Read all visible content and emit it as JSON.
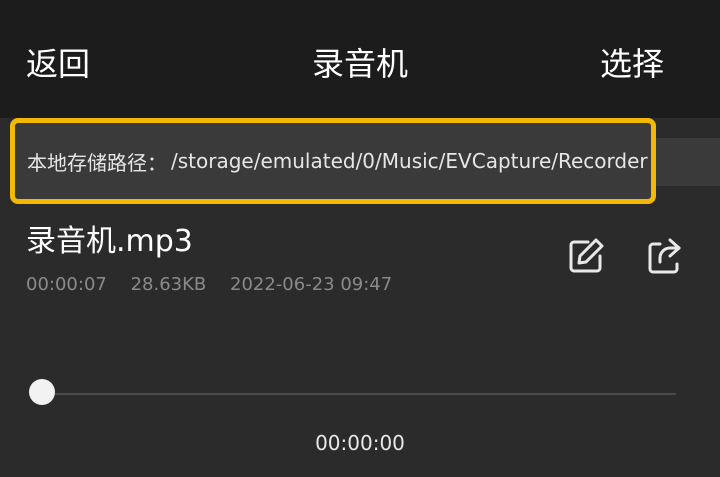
{
  "header": {
    "back_label": "返回",
    "title": "录音机",
    "select_label": "选择"
  },
  "storage": {
    "label": "本地存储路径：",
    "path": "/storage/emulated/0/Music/EVCapture/Recorder"
  },
  "recording": {
    "name": "录音机.mp3",
    "duration": "00:00:07",
    "size": "28.63KB",
    "datetime": "2022-06-23 09:47",
    "actions": [
      {
        "icon": "edit-icon"
      },
      {
        "icon": "share-icon"
      }
    ]
  },
  "player": {
    "current_time": "00:00:00",
    "progress": 0
  },
  "colors": {
    "highlight_border": "#f5b800",
    "header_bg": "#1c1c1c",
    "body_bg": "#2b2b2b"
  }
}
